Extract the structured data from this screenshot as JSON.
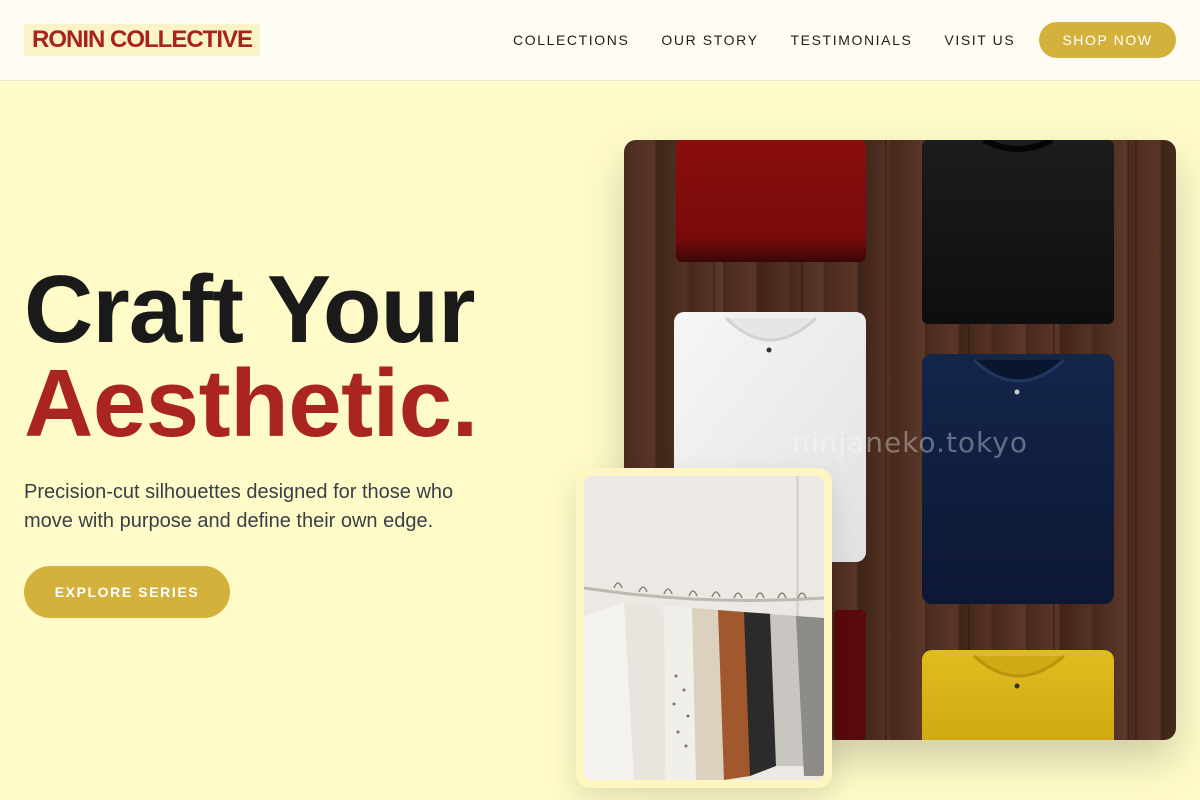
{
  "brand": {
    "logo": "RONIN COLLECTIVE"
  },
  "nav": {
    "items": [
      {
        "label": "COLLECTIONS"
      },
      {
        "label": "OUR STORY"
      },
      {
        "label": "TESTIMONIALS"
      },
      {
        "label": "VISIT US"
      }
    ],
    "shop_label": "SHOP NOW"
  },
  "hero": {
    "line1": "Craft Your",
    "line2": "Aesthetic.",
    "subtitle": "Precision-cut silhouettes designed for those who move with purpose and define their own edge.",
    "cta_label": "EXPLORE SERIES"
  },
  "images": {
    "main_alt": "folded t-shirts on wood",
    "watermark": "ninjaneko.tokyo",
    "overlay_alt": "clothing rack"
  },
  "colors": {
    "background": "#fefbc9",
    "accent": "#d4b13c",
    "brand_red": "#aa2421",
    "text_dark": "#1a1a1a"
  }
}
